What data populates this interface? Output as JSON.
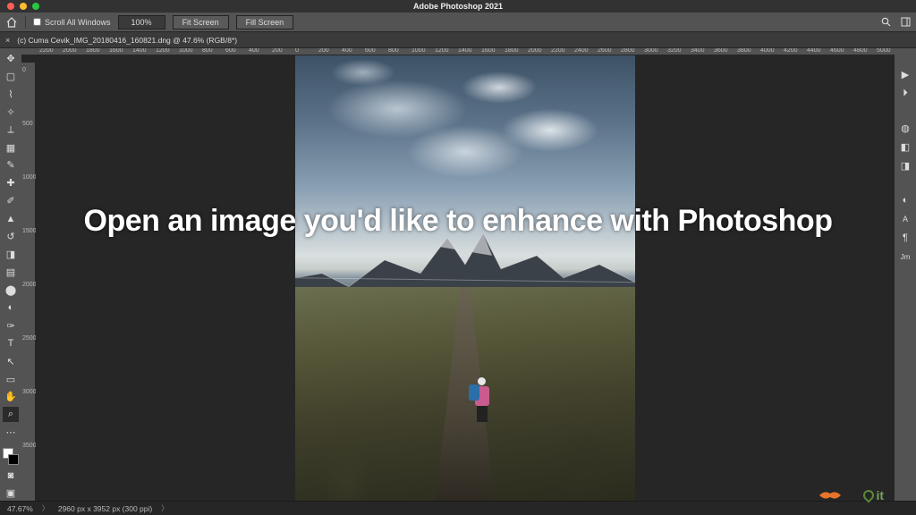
{
  "app": {
    "title": "Adobe Photoshop 2021"
  },
  "optionsbar": {
    "scroll_all": "Scroll All Windows",
    "zoom_pct": "100%",
    "fit_screen": "Fit Screen",
    "fill_screen": "Fill Screen"
  },
  "document": {
    "tab_title": "(c) Cuma Cevik_IMG_20180416_160821.dng @ 47.6% (RGB/8*)"
  },
  "ruler": {
    "h": [
      "2200",
      "2000",
      "1800",
      "1600",
      "1400",
      "1200",
      "1000",
      "800",
      "600",
      "400",
      "200",
      "0",
      "200",
      "400",
      "600",
      "800",
      "1000",
      "1200",
      "1400",
      "1600",
      "1800",
      "2000",
      "2200",
      "2400",
      "2600",
      "2800",
      "3000",
      "3200",
      "3400",
      "3600",
      "3800",
      "4000",
      "4200",
      "4400",
      "4600",
      "4800",
      "5000"
    ],
    "v": [
      "0",
      "500",
      "1000",
      "1500",
      "2000",
      "2500",
      "3000",
      "3500"
    ]
  },
  "tools": {
    "left": [
      "move",
      "marquee",
      "lasso",
      "wand",
      "crop",
      "frame",
      "eyedrop",
      "heal",
      "brush",
      "stamp",
      "history",
      "eraser",
      "gradient",
      "blur",
      "dodge",
      "pen",
      "text",
      "path",
      "rect",
      "hand",
      "zoom",
      "more"
    ],
    "right_top": [
      "play",
      "step",
      "refresh"
    ],
    "right": [
      "color",
      "swatch",
      "grad",
      "brush",
      "history",
      "A",
      "para",
      "jm"
    ]
  },
  "overlay": {
    "caption": "Open an image you'd like to enhance with Photoshop"
  },
  "status": {
    "zoom": "47.67%",
    "doc": "2960 px x 3952 px (300 ppi)"
  }
}
